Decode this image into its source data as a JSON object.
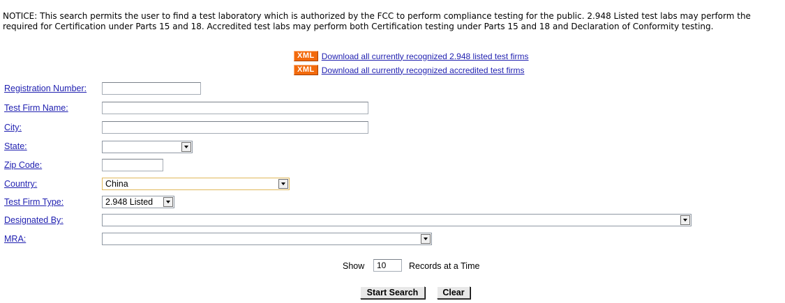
{
  "notice": "NOTICE: This search permits the user to find a test laboratory which is authorized by the FCC to perform compliance testing for the public. 2.948 Listed test labs may perform the\nrequired for Certification under Parts 15 and 18. Accredited test labs may perform both Certification testing under Parts 15 and 18 and Declaration of Conformity testing.",
  "downloads": [
    {
      "badge": "XML",
      "label": "Download all currently recognized 2.948 listed test firms"
    },
    {
      "badge": "XML",
      "label": "Download all currently recognized accredited test firms"
    }
  ],
  "form": {
    "registration_number": {
      "label": "Registration Number:",
      "value": ""
    },
    "test_firm_name": {
      "label": "Test Firm Name:",
      "value": ""
    },
    "city": {
      "label": "City:",
      "value": ""
    },
    "state": {
      "label": "State:",
      "value": ""
    },
    "zip_code": {
      "label": "Zip Code:",
      "value": ""
    },
    "country": {
      "label": "Country:",
      "value": "China"
    },
    "test_firm_type": {
      "label": "Test Firm Type:",
      "value": "2.948 Listed"
    },
    "designated_by": {
      "label": "Designated By:",
      "value": ""
    },
    "mra": {
      "label": "MRA:",
      "value": ""
    }
  },
  "records": {
    "show_label": "Show",
    "value": "10",
    "suffix": "Records at a Time"
  },
  "buttons": {
    "start_search": "Start Search",
    "clear": "Clear"
  },
  "colors": {
    "link": "#1f1fb0",
    "xml_badge": "#f26a0c",
    "highlight_border": "#e0b85a"
  }
}
